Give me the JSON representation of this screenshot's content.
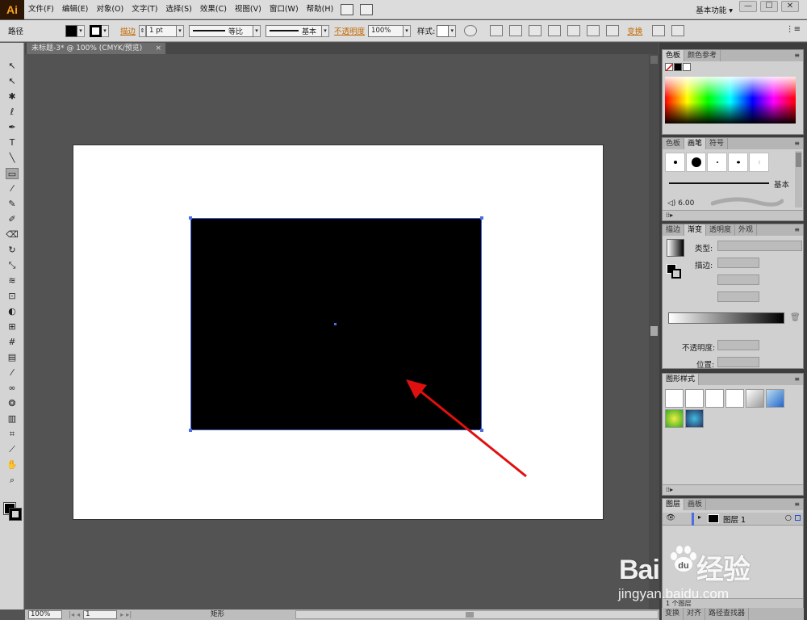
{
  "app": {
    "logo": "Ai",
    "menu": [
      "文件(F)",
      "编辑(E)",
      "对象(O)",
      "文字(T)",
      "选择(S)",
      "效果(C)",
      "视图(V)",
      "窗口(W)",
      "帮助(H)"
    ],
    "workspace": "基本功能",
    "window_controls": [
      "—",
      "☐",
      "✕"
    ]
  },
  "control_bar": {
    "object_type": "路径",
    "stroke_label": "描边",
    "stroke_weight": "1 pt",
    "profile": "等比",
    "brush": "基本",
    "opacity_label": "不透明度",
    "opacity_value": "100%",
    "style_label": "样式",
    "transform_label": "变换"
  },
  "document": {
    "tab_title": "未标题-3* @ 100% (CMYK/预览)",
    "close": "×"
  },
  "status_bar": {
    "zoom": "100%",
    "artboard_number": "1",
    "current_tool": "矩形"
  },
  "panels": {
    "color": {
      "tabs": [
        "色板",
        "颜色参考"
      ]
    },
    "brushes": {
      "tabs": [
        "色板",
        "画笔",
        "符号"
      ],
      "basic_label": "基本",
      "size_value": "6.00"
    },
    "gradient": {
      "tabs": [
        "描边",
        "渐变",
        "透明度",
        "外观"
      ],
      "type_label": "类型",
      "stroke_label": "描边",
      "opacity_label": "不透明度",
      "position_label": "位置"
    },
    "graphic_styles": {
      "tabs": [
        "图形样式"
      ]
    },
    "layers": {
      "tabs": [
        "图层",
        "画板"
      ],
      "layer_name": "图层 1",
      "footer": "1 个图层"
    },
    "bottom_tabs": [
      "变换",
      "对齐",
      "路径查找器"
    ]
  },
  "watermark": {
    "brand_left": "Bai",
    "brand_right": "经验",
    "url": "jingyan.baidu.com"
  },
  "colors": {
    "canvas_bg": "#535353",
    "selection": "#4a6ee0",
    "annotation_arrow": "#e01010"
  }
}
